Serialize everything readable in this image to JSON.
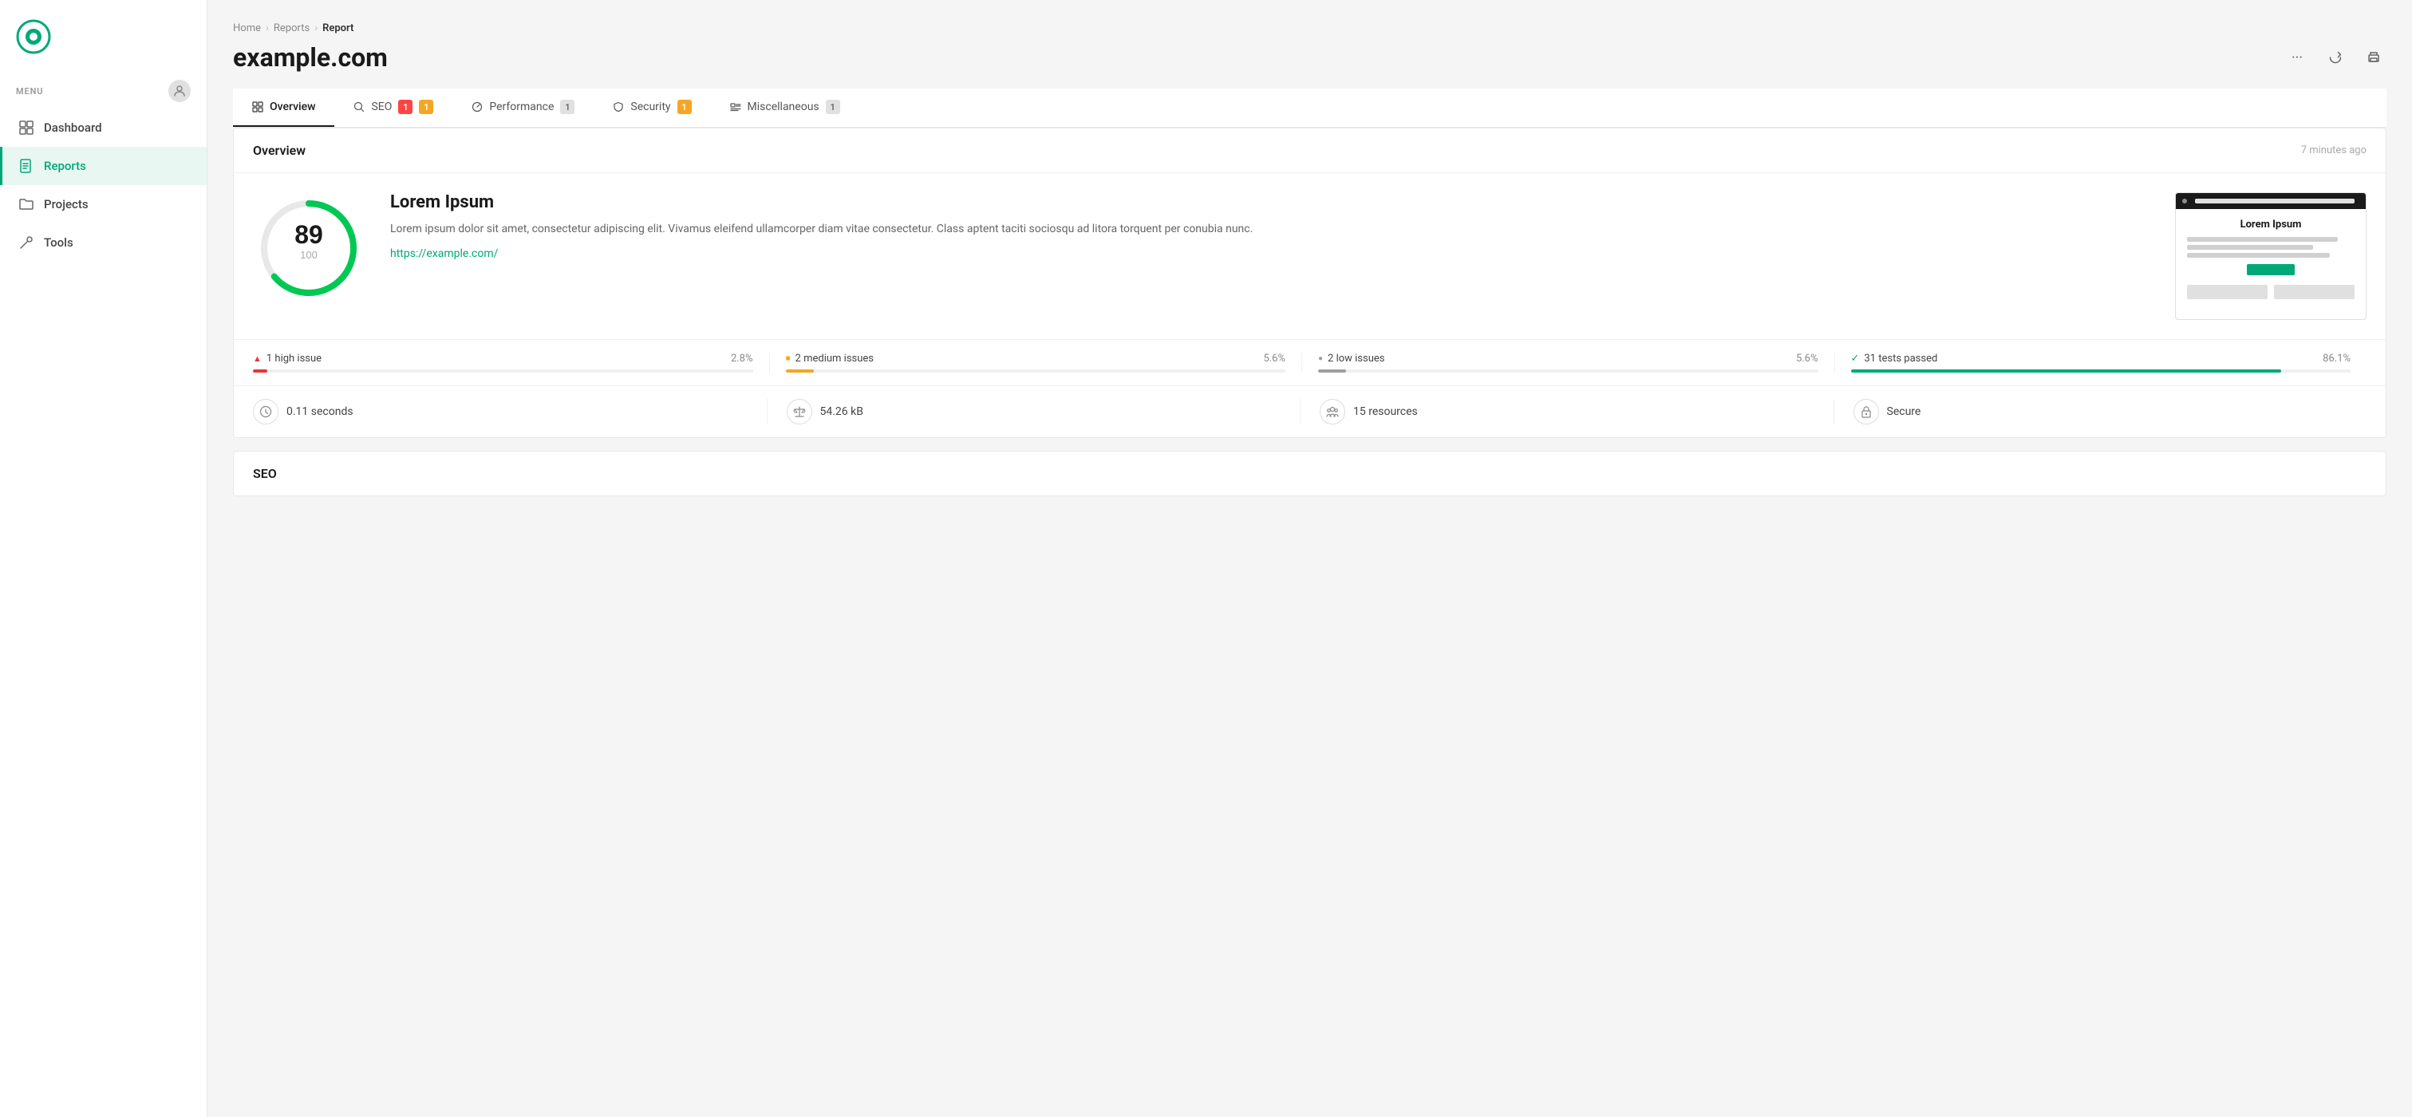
{
  "sidebar": {
    "menu_label": "MENU",
    "nav_items": [
      {
        "id": "dashboard",
        "label": "Dashboard",
        "icon": "grid"
      },
      {
        "id": "reports",
        "label": "Reports",
        "icon": "file-text",
        "active": true
      },
      {
        "id": "projects",
        "label": "Projects",
        "icon": "folder"
      },
      {
        "id": "tools",
        "label": "Tools",
        "icon": "tool"
      }
    ]
  },
  "breadcrumb": {
    "items": [
      "Home",
      "Reports",
      "Report"
    ]
  },
  "page": {
    "title": "example.com"
  },
  "tabs": [
    {
      "id": "overview",
      "label": "Overview",
      "icon": "overview",
      "active": true
    },
    {
      "id": "seo",
      "label": "SEO",
      "icon": "search",
      "badges": [
        {
          "value": "1",
          "type": "red"
        },
        {
          "value": "1",
          "type": "yellow"
        }
      ]
    },
    {
      "id": "performance",
      "label": "Performance",
      "icon": "gauge",
      "badges": [
        {
          "value": "1",
          "type": "gray"
        }
      ]
    },
    {
      "id": "security",
      "label": "Security",
      "icon": "shield",
      "badges": [
        {
          "value": "1",
          "type": "yellow"
        }
      ]
    },
    {
      "id": "miscellaneous",
      "label": "Miscellaneous",
      "icon": "misc",
      "badges": [
        {
          "value": "1",
          "type": "gray"
        }
      ]
    }
  ],
  "overview": {
    "title": "Overview",
    "time": "7 minutes ago",
    "score": {
      "value": "89",
      "max": "100",
      "percent": 89
    },
    "site": {
      "name": "Lorem Ipsum",
      "description": "Lorem ipsum dolor sit amet, consectetur adipiscing elit. Vivamus eleifend ullamcorper diam vitae consectetur. Class aptent taciti sociosqu ad litora torquent per conubia nunc.",
      "url": "https://example.com/"
    },
    "preview": {
      "title": "Lorem Ipsum",
      "button_label": ""
    },
    "issues": [
      {
        "id": "high",
        "icon": "triangle",
        "label": "1 high issue",
        "percent": "2.8%",
        "fill": 2.8,
        "color": "#e53935"
      },
      {
        "id": "medium",
        "icon": "square",
        "label": "2 medium issues",
        "percent": "5.6%",
        "fill": 5.6,
        "color": "#f5a623"
      },
      {
        "id": "low",
        "icon": "circle",
        "label": "2 low issues",
        "percent": "5.6%",
        "fill": 5.6,
        "color": "#9e9e9e"
      },
      {
        "id": "passed",
        "icon": "check",
        "label": "31 tests passed",
        "percent": "86.1%",
        "fill": 86.1,
        "color": "#00a878"
      }
    ],
    "stats": [
      {
        "id": "time",
        "icon": "clock",
        "label": "0.11 seconds"
      },
      {
        "id": "size",
        "icon": "balance",
        "label": "54.26 kB"
      },
      {
        "id": "resources",
        "icon": "people",
        "label": "15 resources"
      },
      {
        "id": "security",
        "icon": "lock",
        "label": "Secure"
      }
    ]
  },
  "seo_section": {
    "title": "SEO"
  }
}
